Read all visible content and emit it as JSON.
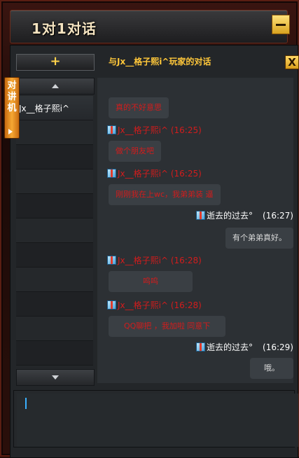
{
  "window": {
    "title": "1对1对话"
  },
  "sidebar": {
    "add_label": "+",
    "walkie_tab": "对讲机",
    "contact": "Jx__格子熙i^"
  },
  "chat": {
    "title": "与Jx__格子熙i^玩家的对话",
    "close_label": "X",
    "messages": [
      {
        "side": "them",
        "sender": "",
        "time": "",
        "text": "真的不好意思"
      },
      {
        "side": "them",
        "sender": "Jx__格子熙i^",
        "time": "(16:25)",
        "text": "做个朋友吧"
      },
      {
        "side": "them",
        "sender": "Jx__格子熙i^",
        "time": "(16:25)",
        "text": "刚刚我在上wc，我弟弟装 逼"
      },
      {
        "side": "me",
        "sender": "逝去的过去°",
        "time": "(16:27)",
        "text": "有个弟弟真好。"
      },
      {
        "side": "them",
        "sender": "Jx__格子熙i^",
        "time": "(16:28)",
        "text": "呜呜"
      },
      {
        "side": "them",
        "sender": "Jx__格子熙i^",
        "time": "(16:28)",
        "text": "QQ聊把 ，我加啦 同意下"
      },
      {
        "side": "me",
        "sender": "逝去的过去°",
        "time": "(16:29)",
        "text": "哦。"
      }
    ]
  },
  "input": {
    "value": ""
  },
  "colors": {
    "accent": "#ffc73a",
    "them_text": "#d21c1c",
    "me_text": "#ffffff"
  },
  "icons": {
    "sender_icon": "gift-box-icon"
  }
}
